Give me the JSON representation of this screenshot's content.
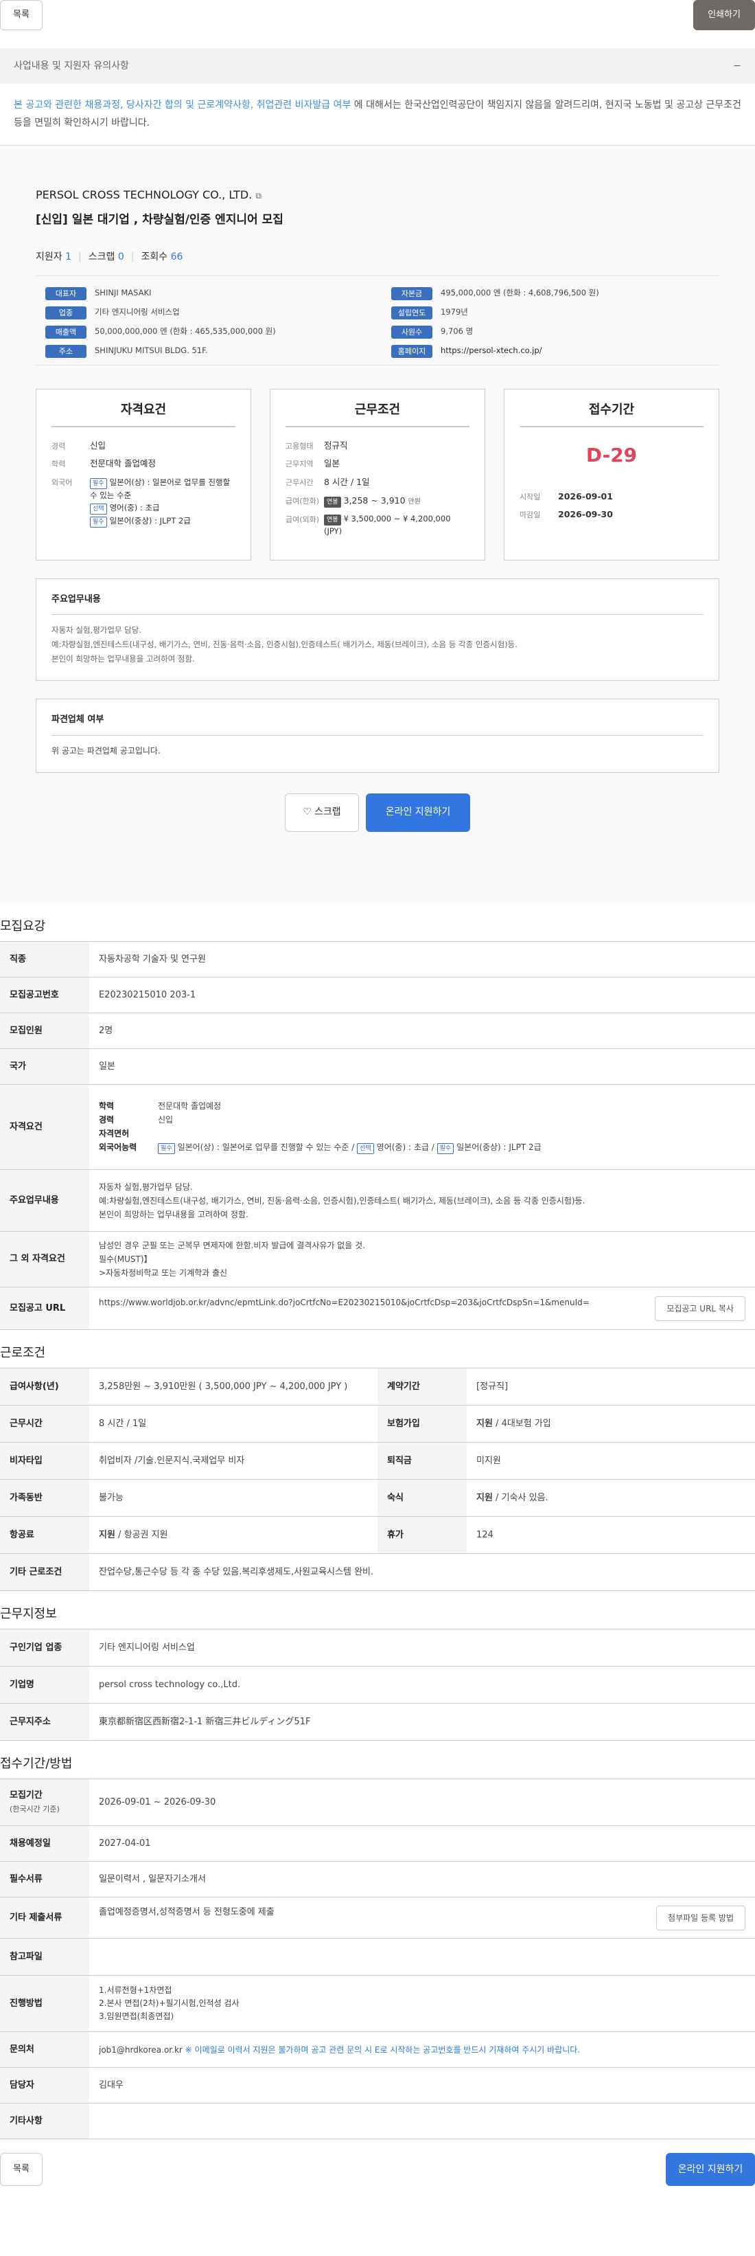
{
  "top": {
    "list": "목록",
    "print": "인쇄하기"
  },
  "notice": {
    "title": "사업내용 및 지원자 유의사항",
    "toggle": "−",
    "link_text": "본 공고와 관련한 채용과정, 당사자간 합의 및 근로계약사항, 취업관련 비자발급 여부",
    "rest": " 에 대해서는 한국산업인력공단이 책임지지 않음을 알려드리며, 현지국 노동법 및 공고상 근무조건 등을 면밀히 확인하시기 바랍니다."
  },
  "summary": {
    "company": "PERSOL CROSS TECHNOLOGY CO., LTD.",
    "title": "[신입] 일본 대기업 , 차량실험/인증 엔지니어 모집",
    "stats": {
      "applicants_label": "지원자",
      "applicants": "1",
      "scraps_label": "스크랩",
      "scraps": "0",
      "views_label": "조회수",
      "views": "66"
    },
    "info": [
      {
        "label": "대표자",
        "value": "SHINJI MASAKI"
      },
      {
        "label": "자본금",
        "value": "495,000,000 엔 (한화 : 4,608,796,500 원)"
      },
      {
        "label": "업종",
        "value": "기타 엔지니어링 서비스업"
      },
      {
        "label": "설립연도",
        "value": "1979년"
      },
      {
        "label": "매출액",
        "value": "50,000,000,000 엔 (한화 : 465,535,000,000 원)"
      },
      {
        "label": "사원수",
        "value": "9,706 명"
      },
      {
        "label": "주소",
        "value": "SHINJUKU MITSUI BLDG. 51F."
      },
      {
        "label": "홈페이지",
        "value": "https://persol-xtech.co.jp/"
      }
    ],
    "qual": {
      "title": "자격요건",
      "edu_k": "경력",
      "edu_v": "신입",
      "school_k": "학력",
      "school_v": "전문대학 졸업예정",
      "lang_k": "외국어",
      "lang1_tag": "필수",
      "lang1": "일본어(상) : 일본어로 업무를 진행할 수 있는 수준",
      "lang2_tag": "선택",
      "lang2": "영어(중) : 초급",
      "lang3_tag": "필수",
      "lang3": "일본어(중상) : JLPT 2급"
    },
    "cond": {
      "title": "근무조건",
      "type_k": "고용형태",
      "type_v": "정규직",
      "region_k": "근무지역",
      "region_v": "일본",
      "hours_k": "근무시간",
      "hours_v": "8 시간 / 1일",
      "salk_k": "급여(한화)",
      "salk_tag": "연봉",
      "salk_v": "3,258 ~ 3,910",
      "salk_unit": "만원",
      "salf_k": "급여(외화)",
      "salf_tag": "연봉",
      "salf_v": "¥ 3,500,000 ~ ¥ 4,200,000 (JPY)"
    },
    "period": {
      "title": "접수기간",
      "dday": "D-29",
      "start_k": "시작일",
      "start_v": "2026-09-01",
      "end_k": "마감일",
      "end_v": "2026-09-30"
    },
    "duty": {
      "title": "주요업무내용",
      "l1": "자동차 실험,평가업무 담당.",
      "l2": "예:차량실험,엔진테스트(내구성, 배기가스, 연비, 진동·음력·소음, 인증시험),인증테스트( 배기가스, 제동(브레이크), 소음 등 각종 인증시험)등.",
      "l3": "본인이 희망하는 업무내용을 고려하여 정함."
    },
    "dispatch": {
      "title": "파견업체 여부",
      "text": "위 공고는 파견업체 공고입니다."
    },
    "scrap": "스크랩",
    "apply": "온라인 지원하기"
  },
  "recruit": {
    "section": "모집요강",
    "job_h": "직종",
    "job_v": "자동차공학 기술자 및 연구원",
    "no_h": "모집공고번호",
    "no_v": "E20230215010 203-1",
    "count_h": "모집인원",
    "count_v": "2명",
    "country_h": "국가",
    "country_v": "일본",
    "qual_h": "자격요건",
    "school_k": "학력",
    "school_v": "전문대학 졸업예정",
    "career_k": "경력",
    "career_v": "신입",
    "license_k": "자격면허",
    "license_v": "",
    "lang_k": "외국어능력",
    "lang1_tag": "필수",
    "lang1": "일본어(상) : 일본어로 업무를 진행할 수 있는 수준",
    "lang2_tag": "선택",
    "lang2": "영어(중) : 초급",
    "lang3_tag": "필수",
    "lang3": "일본어(중상) : JLPT 2급",
    "duty_h": "주요업무내용",
    "duty1": "자동차 실험,평가업무 담당.",
    "duty2": "예:차량실험,엔진테스트(내구성, 배기가스, 연비, 진동·음력·소음, 인증시험),인증테스트( 배기가스, 제동(브레이크), 소음 등 각종 인증시험)등.",
    "duty3": "본인이 희망하는 업무내용을 고려하여 정함.",
    "etc_h": "그 외 자격요건",
    "etc1": "남성인 경우 군필 또는 군복무 면제자에 한함.비자 발급에 결격사유가 없을 것.",
    "etc2": "필수(MUST)】",
    "etc3": ">자동차정비학교 또는 기계학과 출신",
    "url_h": "모집공고 URL",
    "url_v": "https://www.worldjob.or.kr/advnc/epmtLink.do?joCrtfcNo=E20230215010&joCrtfcDsp=203&joCrtfcDspSn=1&menuId=",
    "url_btn": "모집공고 URL 복사"
  },
  "work": {
    "section": "근로조건",
    "sal_h": "급여사항(년)",
    "sal_v": "3,258만원 ~ 3,910만원 ( 3,500,000 JPY ~ 4,200,000 JPY )",
    "contract_h": "계약기간",
    "contract_v": "[정규직]",
    "hours_h": "근무시간",
    "hours_v": "8 시간 / 1일",
    "ins_h": "보험가입",
    "ins_b": "지원",
    "ins_v": " / 4대보험 가입",
    "visa_h": "비자타입",
    "visa_v": "취업비자 /기술.인문지식.국제업무 비자",
    "sev_h": "퇴직금",
    "sev_v": "미지원",
    "family_h": "가족동반",
    "family_v": "불가능",
    "dorm_h": "숙식",
    "dorm_b": "지원",
    "dorm_v": " / 기숙사 있음.",
    "air_h": "항공료",
    "air_b": "지원",
    "air_v": " / 항공권 지원",
    "leave_h": "휴가",
    "leave_v": "124",
    "other_h": "기타 근로조건",
    "other_v": "잔업수당,통근수당 등 각 종 수당 있음.복리후생제도,사원교육시스템 완비."
  },
  "place": {
    "section": "근무지정보",
    "ind_h": "구인기업 업종",
    "ind_v": "기타 엔지니어링 서비스업",
    "name_h": "기업명",
    "name_v": "persol cross technology co.,Ltd.",
    "addr_h": "근무지주소",
    "addr_v": "東京都新宿区西新宿2-1-1 新宿三井ビルディング51F"
  },
  "method": {
    "section": "접수기간/방법",
    "period_h": "모집기간",
    "period_sub": "(한국시간 기준)",
    "period_v": "2026-09-01 ~ 2026-09-30",
    "hire_h": "채용예정일",
    "hire_v": "2027-04-01",
    "docs_h": "필수서류",
    "docs_v": "일문이력서 , 일문자기소개서",
    "extra_h": "기타 제출서류",
    "extra_v": "졸업예정증명서,성적증명서 등 전형도중에 제출",
    "extra_btn": "첨부파일 등록 방법",
    "ref_h": "참고파일",
    "ref_v": "",
    "proc_h": "진행방법",
    "proc1": "1.서류전형+1차면접",
    "proc2": "2.본사 면접(2차)+필기시험,인적성 검사",
    "proc3": "3.임원면접(최종면접)",
    "contact_h": "문의처",
    "contact_v": "job1@hrdkorea.or.kr",
    "contact_note": "※ 이메일로 이력서 지원은 불가하며 공고 관련 문의 시 E로 시작하는 공고번호를 반드시 기재하여 주시기 바랍니다.",
    "person_h": "담당자",
    "person_v": "김대우",
    "misc_h": "기타사항",
    "misc_v": ""
  },
  "bottom": {
    "list": "목록",
    "apply": "온라인 지원하기"
  }
}
